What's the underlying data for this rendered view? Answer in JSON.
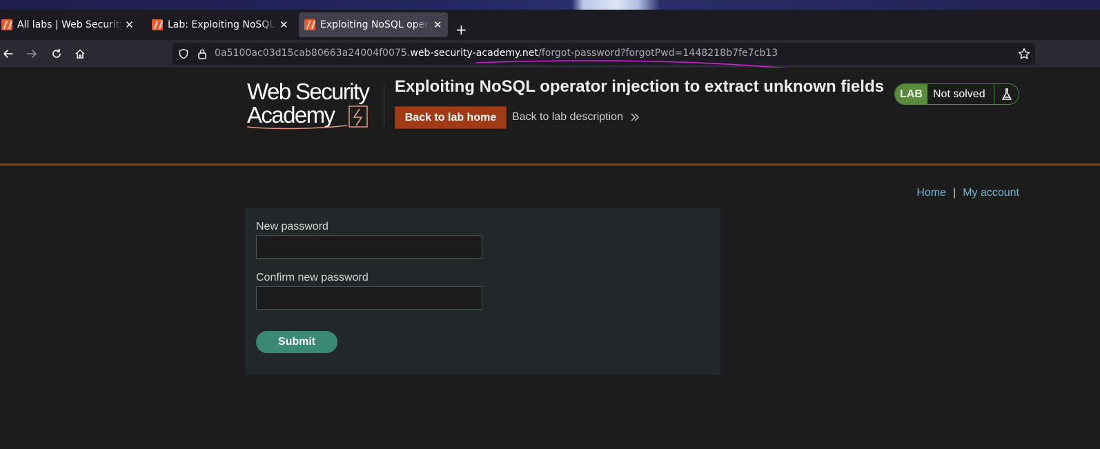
{
  "browser": {
    "tabs": [
      {
        "title": "All labs | Web Security Academy",
        "active": false
      },
      {
        "title": "Lab: Exploiting NoSQL operator injection to extract unknown fields",
        "active": false
      },
      {
        "title": "Exploiting NoSQL operator injection to extract unknown fields",
        "active": true
      }
    ],
    "close_glyph": "✕",
    "new_tab_glyph": "+",
    "url": {
      "prefix": "0a5100ac03d15cab80663a24004f0075.",
      "host": "web-security-academy.net",
      "path": "/forgot-password?forgotPwd=1448218b7fe7cb13"
    },
    "nav_icons": [
      "back-arrow-icon",
      "forward-arrow-icon",
      "reload-icon",
      "home-icon"
    ]
  },
  "lab_header": {
    "logo_line1": "Web Security",
    "logo_line2": "Academy",
    "title": "Exploiting NoSQL operator injection to extract unknown fields",
    "back_home_label": "Back to lab home",
    "back_description_label": "Back to lab description",
    "status_tag": "LAB",
    "status_text": "Not solved"
  },
  "top_nav": {
    "home": "Home",
    "separator": "|",
    "my_account": "My account"
  },
  "form": {
    "new_password_label": "New password",
    "confirm_password_label": "Confirm new password",
    "new_password_value": "",
    "confirm_password_value": "",
    "submit_label": "Submit"
  },
  "colors": {
    "header_accent": "#9e3715",
    "button_primary": "#a13b16",
    "lab_status_green": "#5a8a3c",
    "link_blue": "#6fb6d6",
    "submit_green": "#3a8a73"
  }
}
